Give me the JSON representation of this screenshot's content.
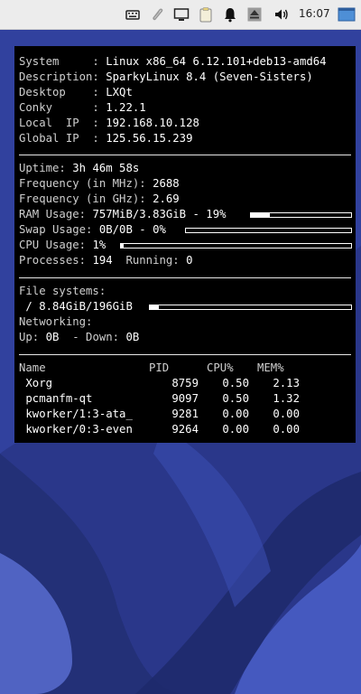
{
  "panel": {
    "clock": "16:07",
    "tray_icons": [
      "keyboard-icon",
      "paperclip-icon",
      "display-icon",
      "clipboard-icon",
      "bell-icon",
      "eject-icon",
      "volume-icon",
      "desktop-switcher-icon"
    ]
  },
  "conky": {
    "info": [
      {
        "label": "System     : ",
        "value": "Linux x86_64 6.12.101+deb13-amd64"
      },
      {
        "label": "Description: ",
        "value": "SparkyLinux 8.4 (Seven-Sisters)"
      },
      {
        "label": "Desktop    : ",
        "value": "LXQt"
      },
      {
        "label": "Conky      : ",
        "value": "1.22.1"
      },
      {
        "label": "Local  IP  : ",
        "value": "192.168.10.128"
      },
      {
        "label": "Global IP  : ",
        "value": "125.56.15.239"
      }
    ],
    "uptime": {
      "label": "Uptime: ",
      "value": "3h 46m 58s"
    },
    "freq_mhz": {
      "label": "Frequency (in MHz): ",
      "value": "2688"
    },
    "freq_ghz": {
      "label": "Frequency (in GHz): ",
      "value": "2.69"
    },
    "ram": {
      "label": "RAM Usage: ",
      "value": "757MiB/3.83GiB - 19%",
      "percent": 19
    },
    "swap": {
      "label": "Swap Usage: ",
      "value": "0B/0B - 0%",
      "percent": 0
    },
    "cpu": {
      "label": "CPU Usage: ",
      "value": "1%",
      "percent": 1
    },
    "processes": {
      "label": "Processes: ",
      "value": "194",
      "running_label": "  Running: ",
      "running_value": "0"
    },
    "filesystems": {
      "label": "File systems:",
      "entry": " / 8.84GiB/196GiB",
      "percent": 4.5
    },
    "networking": {
      "label": "Networking:",
      "up_label": "Up: ",
      "up_value": "0B",
      "down_label": "  - Down: ",
      "down_value": "0B"
    },
    "process_table": {
      "headers": [
        "Name",
        "PID",
        "CPU%",
        "MEM%"
      ],
      "rows": [
        {
          "name": " Xorg",
          "pid": "8759",
          "cpu": "0.50",
          "mem": "2.13"
        },
        {
          "name": " pcmanfm-qt",
          "pid": "9097",
          "cpu": "0.50",
          "mem": "1.32"
        },
        {
          "name": " kworker/1:3-ata_",
          "pid": "9281",
          "cpu": "0.00",
          "mem": "0.00"
        },
        {
          "name": " kworker/0:3-even",
          "pid": "9264",
          "cpu": "0.00",
          "mem": "0.00"
        }
      ]
    }
  }
}
